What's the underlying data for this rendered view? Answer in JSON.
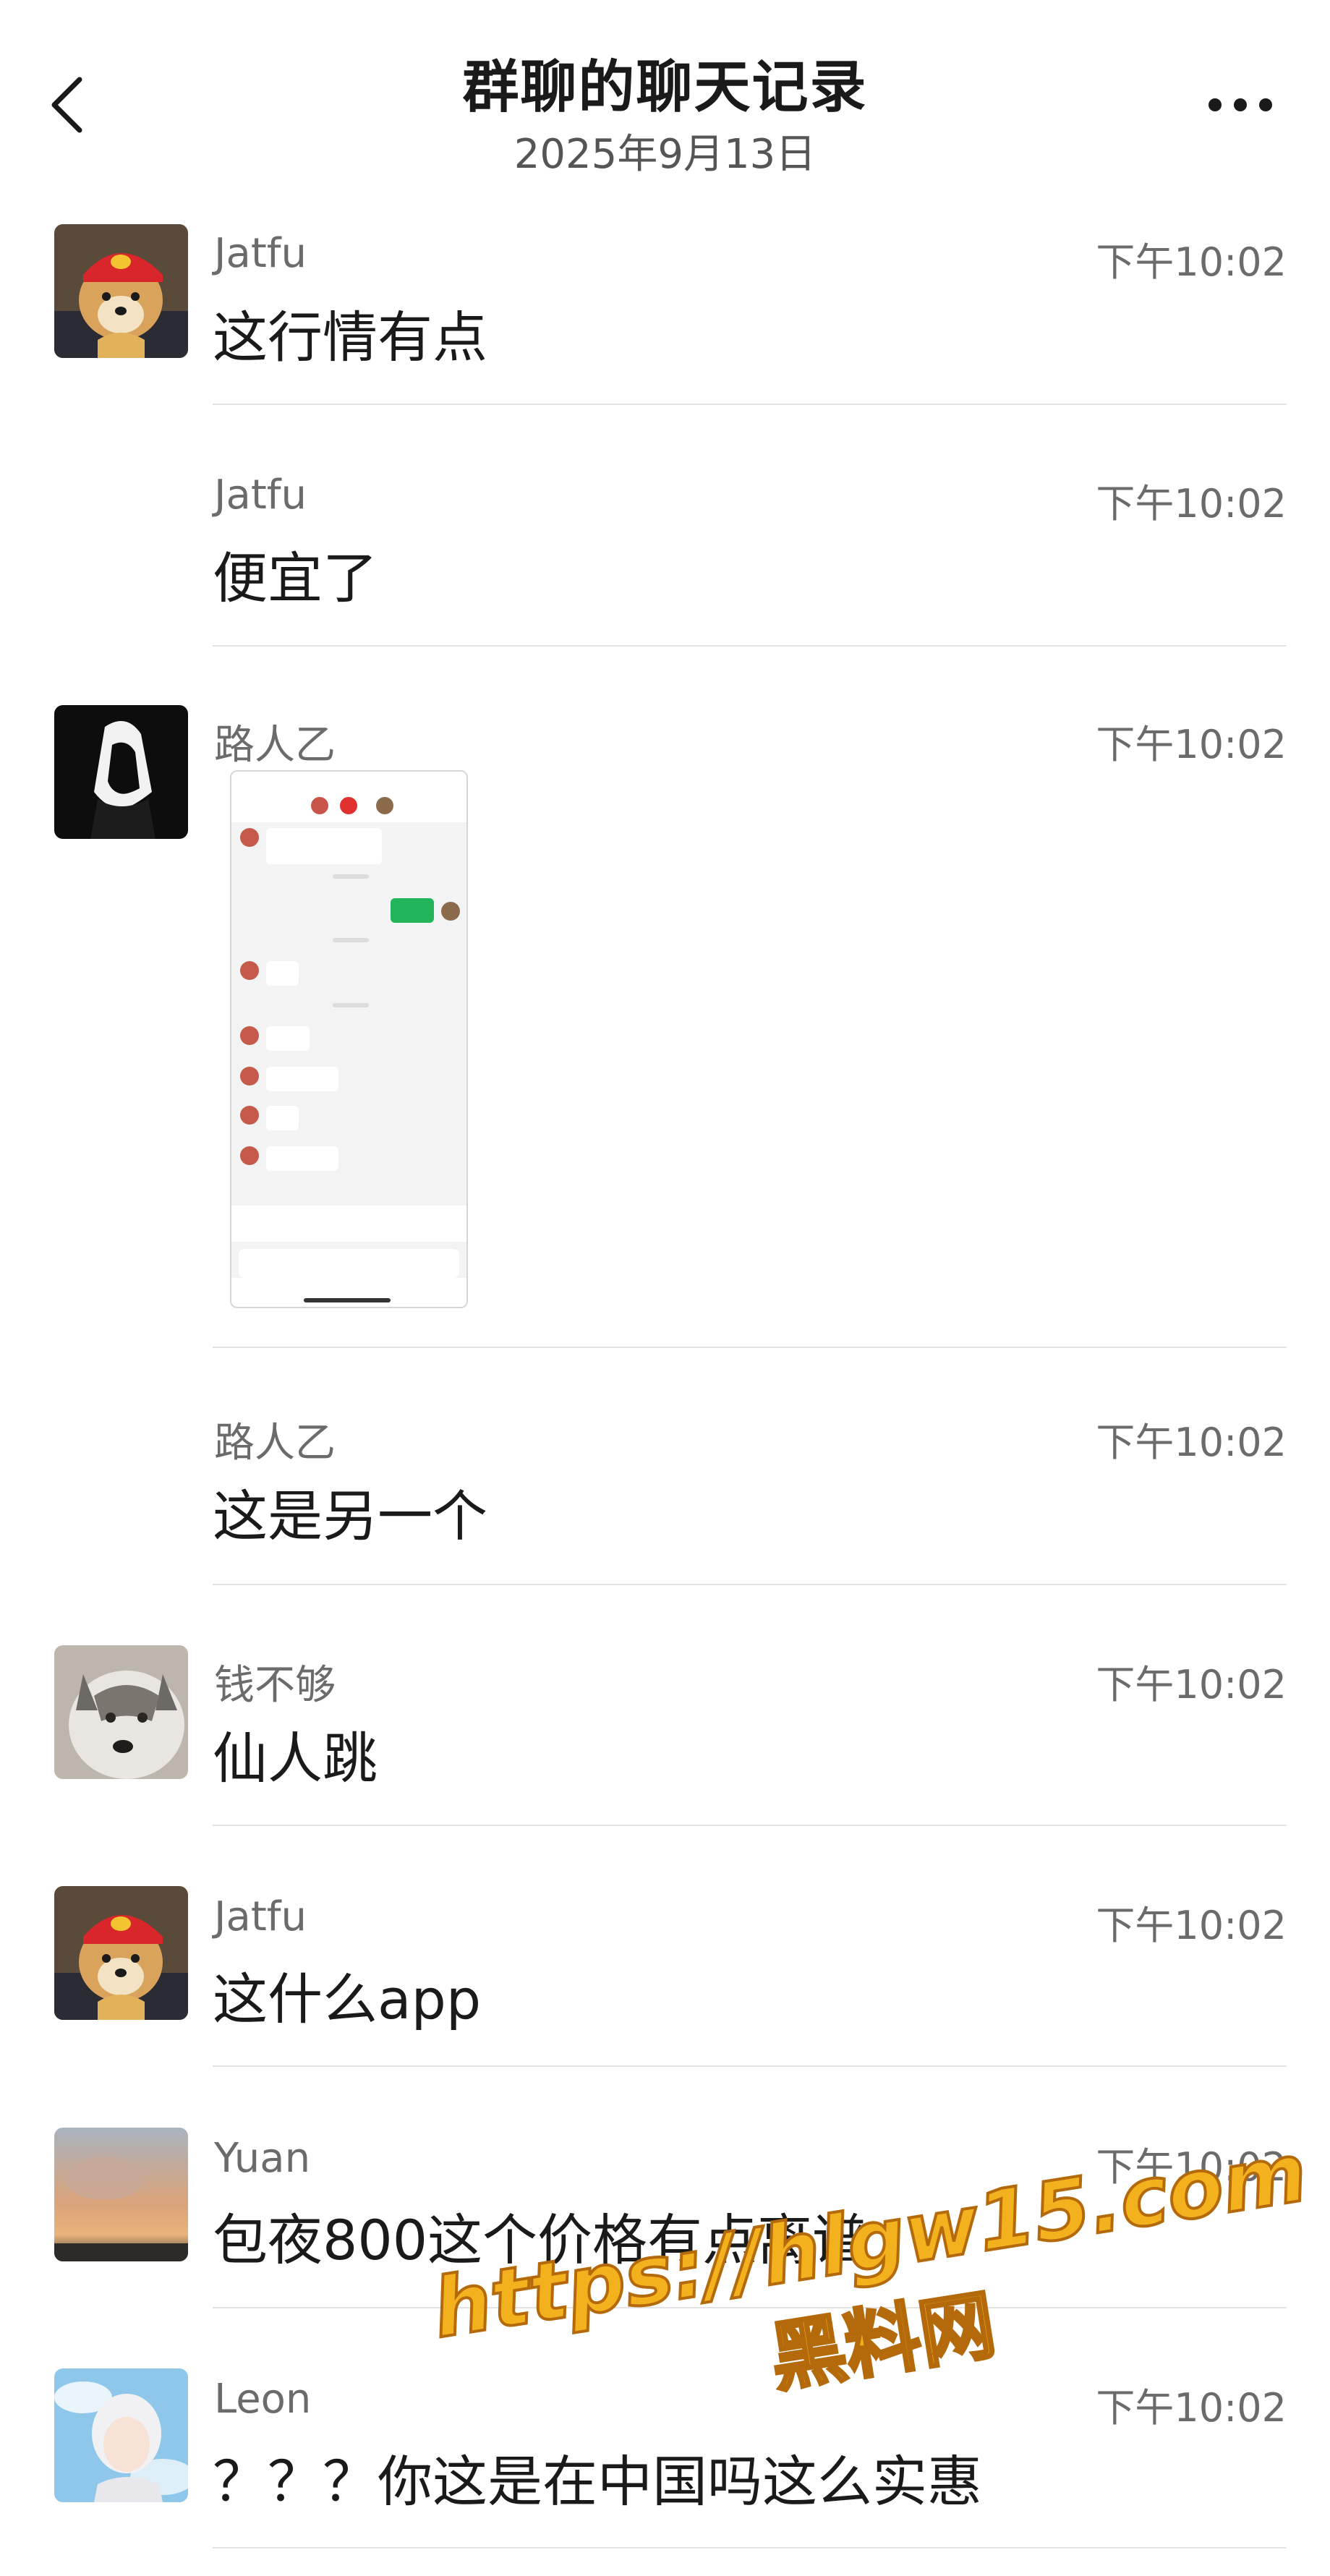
{
  "header": {
    "title": "群聊的聊天记录",
    "date": "2025年9月13日"
  },
  "messages": [
    {
      "sender": "Jatfu",
      "time": "下午10:02",
      "text": "这行情有点",
      "avatar": "shiba-red-hat"
    },
    {
      "sender": "Jatfu",
      "time": "下午10:02",
      "text": "便宜了"
    },
    {
      "sender": "路人乙",
      "time": "下午10:02",
      "text": "",
      "avatar": "hooded-figure",
      "attachment": "chat-screenshot-image"
    },
    {
      "sender": "路人乙",
      "time": "下午10:02",
      "text": "这是另一个"
    },
    {
      "sender": "钱不够",
      "time": "下午10:02",
      "text": "仙人跳",
      "avatar": "husky-dog"
    },
    {
      "sender": "Jatfu",
      "time": "下午10:02",
      "text": "这什么app",
      "avatar": "shiba-red-hat"
    },
    {
      "sender": "Yuan",
      "time": "下午10:02",
      "text": "包夜800这个价格有点离谱",
      "avatar": "sunset-sky"
    },
    {
      "sender": "Leon",
      "time": "下午10:02",
      "text": "？？？你这是在中国吗这么实惠",
      "avatar": "white-hair-person"
    }
  ],
  "watermark": {
    "url": "https://hlgw15.com",
    "name": "黑料网"
  },
  "colors": {
    "background": "#ffffff",
    "secondary_text": "#6b6b6b",
    "divider": "#e3e3e3",
    "watermark": "#f4b11e"
  }
}
